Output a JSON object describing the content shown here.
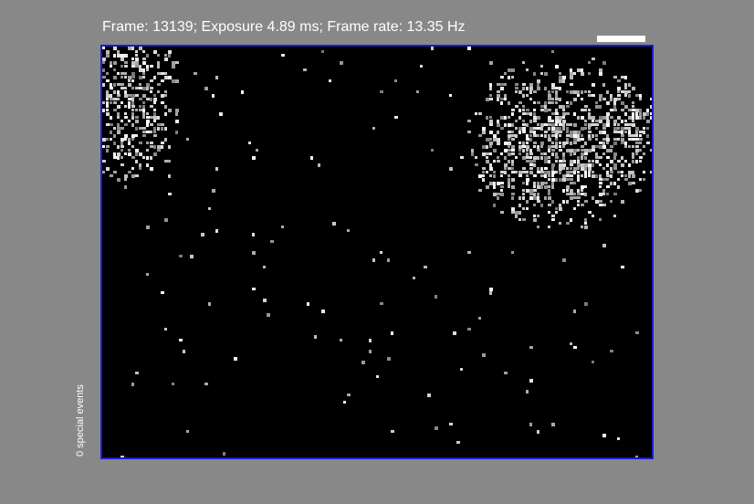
{
  "status_text": "Frame: 13139; Exposure 4.89 ms; Frame rate: 13.35 Hz",
  "side_label": "0 special events",
  "colors": {
    "background": "#888888",
    "border": "#1a1ad0",
    "image_background": "#000000",
    "text": "#ffffff"
  }
}
